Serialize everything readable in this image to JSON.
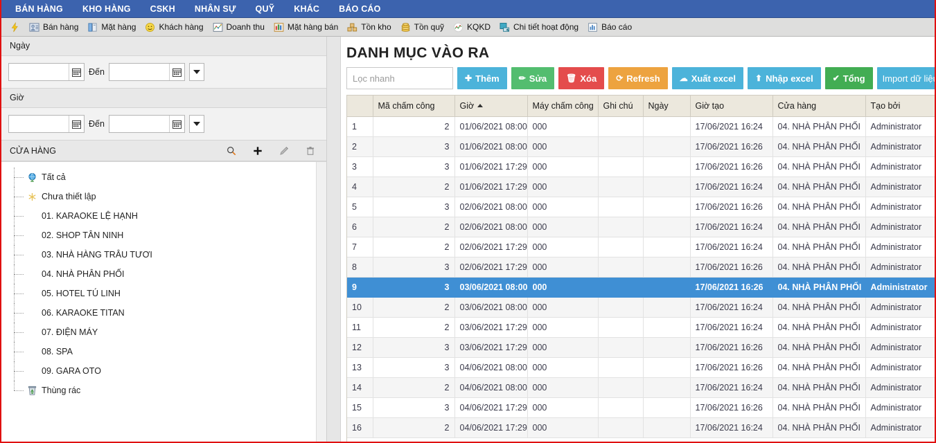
{
  "menubar": {
    "items": [
      {
        "label": "BÁN HÀNG",
        "name": "menu-ban-hang"
      },
      {
        "label": "KHO HÀNG",
        "name": "menu-kho-hang"
      },
      {
        "label": "CSKH",
        "name": "menu-cskh"
      },
      {
        "label": "NHÂN SỰ",
        "name": "menu-nhan-su"
      },
      {
        "label": "QUỸ",
        "name": "menu-quy"
      },
      {
        "label": "KHÁC",
        "name": "menu-khac"
      },
      {
        "label": "BÁO CÁO",
        "name": "menu-bao-cao"
      }
    ]
  },
  "toolbar": {
    "items": [
      {
        "label": "",
        "icon": "lightning-icon",
        "name": "toolbar-lightning"
      },
      {
        "label": "Bán hàng",
        "icon": "sales-person-icon",
        "name": "toolbar-ban-hang"
      },
      {
        "label": "Mặt hàng",
        "icon": "product-icon",
        "name": "toolbar-mat-hang"
      },
      {
        "label": "Khách hàng",
        "icon": "customer-face-icon",
        "name": "toolbar-khach-hang"
      },
      {
        "label": "Doanh thu",
        "icon": "revenue-chart-icon",
        "name": "toolbar-doanh-thu"
      },
      {
        "label": "Mặt hàng bán",
        "icon": "bar-chart-icon",
        "name": "toolbar-mat-hang-ban"
      },
      {
        "label": "Tồn kho",
        "icon": "boxes-icon",
        "name": "toolbar-ton-kho"
      },
      {
        "label": "Tồn quỹ",
        "icon": "coins-icon",
        "name": "toolbar-ton-quy"
      },
      {
        "label": "KQKD",
        "icon": "line-chart-icon",
        "name": "toolbar-kqkd"
      },
      {
        "label": "Chi tiết hoạt động",
        "icon": "activity-icon",
        "name": "toolbar-chi-tiet-hoat-dong"
      },
      {
        "label": "Báo cáo",
        "icon": "report-icon",
        "name": "toolbar-bao-cao"
      }
    ]
  },
  "filters": {
    "date": {
      "label": "Ngày",
      "from_value": "",
      "to_value": "",
      "between_label": "Đến"
    },
    "time": {
      "label": "Giờ",
      "from_value": "",
      "to_value": "",
      "between_label": "Đến"
    }
  },
  "store_panel": {
    "title": "CỬA HÀNG",
    "actions": [
      {
        "name": "search-icon",
        "glyph": "search"
      },
      {
        "name": "add-icon",
        "glyph": "plus"
      },
      {
        "name": "edit-icon",
        "glyph": "pencil"
      },
      {
        "name": "delete-icon",
        "glyph": "trash"
      }
    ],
    "tree": [
      {
        "label": "Tất cả",
        "icon": "globe-icon"
      },
      {
        "label": "Chưa thiết lập",
        "icon": "asterisk-icon"
      },
      {
        "label": "01. KARAOKE LỆ HẠNH",
        "icon": ""
      },
      {
        "label": "02. SHOP TÂN NINH",
        "icon": ""
      },
      {
        "label": "03. NHÀ HÀNG TRÂU TƯƠI",
        "icon": ""
      },
      {
        "label": "04. NHÀ PHÂN PHỐI",
        "icon": ""
      },
      {
        "label": "05. HOTEL TÚ LINH",
        "icon": ""
      },
      {
        "label": "06. KARAOKE TITAN",
        "icon": ""
      },
      {
        "label": "07. ĐIỆN MÁY",
        "icon": ""
      },
      {
        "label": "08. SPA",
        "icon": ""
      },
      {
        "label": "09. GARA OTO",
        "icon": ""
      },
      {
        "label": "Thùng rác",
        "icon": "recycle-bin-icon"
      }
    ]
  },
  "main": {
    "title": "DANH MỤC VÀO RA",
    "quick_filter_placeholder": "Lọc nhanh",
    "quick_filter_value": "",
    "buttons": [
      {
        "label": "Thêm",
        "glyph": "+",
        "name": "add-button"
      },
      {
        "label": "Sửa",
        "glyph": "✎",
        "name": "edit-button"
      },
      {
        "label": "Xóa",
        "glyph": "🗑",
        "name": "delete-button"
      },
      {
        "label": "Refresh",
        "glyph": "⟳",
        "name": "refresh-button"
      },
      {
        "label": "Xuất excel",
        "glyph": "☁",
        "name": "export-excel-button"
      },
      {
        "label": "Nhập excel",
        "glyph": "⬆",
        "name": "import-excel-button"
      },
      {
        "label": "Tổng",
        "glyph": "✔",
        "name": "total-button"
      },
      {
        "label": "Import dữ liệu vào ra",
        "glyph": "",
        "name": "import-data-button"
      }
    ],
    "colors": {
      "add": "#4cb3da",
      "edit": "#53bd6f",
      "delete": "#e44c4c",
      "refresh": "#eda33f",
      "total": "#42ad53",
      "selected_row": "#3f8fd4",
      "menubar": "#3c63ae",
      "border": "#e01010"
    },
    "table": {
      "columns": [
        {
          "label": "",
          "key": "idx",
          "cls": "c-idx"
        },
        {
          "label": "Mã chấm công",
          "key": "ma",
          "cls": "c-ma"
        },
        {
          "label": "Giờ",
          "key": "gio",
          "cls": "c-gio",
          "sort": "asc"
        },
        {
          "label": "Máy chấm công",
          "key": "may",
          "cls": "c-may"
        },
        {
          "label": "Ghi chú",
          "key": "ghichu",
          "cls": "c-ghi"
        },
        {
          "label": "Ngày",
          "key": "ngay",
          "cls": "c-ngay"
        },
        {
          "label": "Giờ tạo",
          "key": "giotao",
          "cls": "c-giotao"
        },
        {
          "label": "Cửa hàng",
          "key": "cuahang",
          "cls": "c-cuahang"
        },
        {
          "label": "Tạo bởi",
          "key": "taoboi",
          "cls": "c-taoboi"
        }
      ],
      "selected_index": 9,
      "rows": [
        {
          "idx": "1",
          "ma": "2",
          "gio": "01/06/2021 08:00",
          "may": "000",
          "ghichu": "",
          "ngay": "",
          "giotao": "17/06/2021 16:24",
          "cuahang": "04. NHÀ PHÂN PHỐI",
          "taoboi": "Administrator"
        },
        {
          "idx": "2",
          "ma": "3",
          "gio": "01/06/2021 08:00",
          "may": "000",
          "ghichu": "",
          "ngay": "",
          "giotao": "17/06/2021 16:26",
          "cuahang": "04. NHÀ PHÂN PHỐI",
          "taoboi": "Administrator"
        },
        {
          "idx": "3",
          "ma": "3",
          "gio": "01/06/2021 17:29",
          "may": "000",
          "ghichu": "",
          "ngay": "",
          "giotao": "17/06/2021 16:26",
          "cuahang": "04. NHÀ PHÂN PHỐI",
          "taoboi": "Administrator"
        },
        {
          "idx": "4",
          "ma": "2",
          "gio": "01/06/2021 17:29",
          "may": "000",
          "ghichu": "",
          "ngay": "",
          "giotao": "17/06/2021 16:24",
          "cuahang": "04. NHÀ PHÂN PHỐI",
          "taoboi": "Administrator"
        },
        {
          "idx": "5",
          "ma": "3",
          "gio": "02/06/2021 08:00",
          "may": "000",
          "ghichu": "",
          "ngay": "",
          "giotao": "17/06/2021 16:26",
          "cuahang": "04. NHÀ PHÂN PHỐI",
          "taoboi": "Administrator"
        },
        {
          "idx": "6",
          "ma": "2",
          "gio": "02/06/2021 08:00",
          "may": "000",
          "ghichu": "",
          "ngay": "",
          "giotao": "17/06/2021 16:24",
          "cuahang": "04. NHÀ PHÂN PHỐI",
          "taoboi": "Administrator"
        },
        {
          "idx": "7",
          "ma": "2",
          "gio": "02/06/2021 17:29",
          "may": "000",
          "ghichu": "",
          "ngay": "",
          "giotao": "17/06/2021 16:24",
          "cuahang": "04. NHÀ PHÂN PHỐI",
          "taoboi": "Administrator"
        },
        {
          "idx": "8",
          "ma": "3",
          "gio": "02/06/2021 17:29",
          "may": "000",
          "ghichu": "",
          "ngay": "",
          "giotao": "17/06/2021 16:26",
          "cuahang": "04. NHÀ PHÂN PHỐI",
          "taoboi": "Administrator"
        },
        {
          "idx": "9",
          "ma": "3",
          "gio": "03/06/2021 08:00",
          "may": "000",
          "ghichu": "",
          "ngay": "",
          "giotao": "17/06/2021 16:26",
          "cuahang": "04. NHÀ PHÂN PHỐI",
          "taoboi": "Administrator"
        },
        {
          "idx": "10",
          "ma": "2",
          "gio": "03/06/2021 08:00",
          "may": "000",
          "ghichu": "",
          "ngay": "",
          "giotao": "17/06/2021 16:24",
          "cuahang": "04. NHÀ PHÂN PHỐI",
          "taoboi": "Administrator"
        },
        {
          "idx": "11",
          "ma": "2",
          "gio": "03/06/2021 17:29",
          "may": "000",
          "ghichu": "",
          "ngay": "",
          "giotao": "17/06/2021 16:24",
          "cuahang": "04. NHÀ PHÂN PHỐI",
          "taoboi": "Administrator"
        },
        {
          "idx": "12",
          "ma": "3",
          "gio": "03/06/2021 17:29",
          "may": "000",
          "ghichu": "",
          "ngay": "",
          "giotao": "17/06/2021 16:26",
          "cuahang": "04. NHÀ PHÂN PHỐI",
          "taoboi": "Administrator"
        },
        {
          "idx": "13",
          "ma": "3",
          "gio": "04/06/2021 08:00",
          "may": "000",
          "ghichu": "",
          "ngay": "",
          "giotao": "17/06/2021 16:26",
          "cuahang": "04. NHÀ PHÂN PHỐI",
          "taoboi": "Administrator"
        },
        {
          "idx": "14",
          "ma": "2",
          "gio": "04/06/2021 08:00",
          "may": "000",
          "ghichu": "",
          "ngay": "",
          "giotao": "17/06/2021 16:24",
          "cuahang": "04. NHÀ PHÂN PHỐI",
          "taoboi": "Administrator"
        },
        {
          "idx": "15",
          "ma": "3",
          "gio": "04/06/2021 17:29",
          "may": "000",
          "ghichu": "",
          "ngay": "",
          "giotao": "17/06/2021 16:26",
          "cuahang": "04. NHÀ PHÂN PHỐI",
          "taoboi": "Administrator"
        },
        {
          "idx": "16",
          "ma": "2",
          "gio": "04/06/2021 17:29",
          "may": "000",
          "ghichu": "",
          "ngay": "",
          "giotao": "17/06/2021 16:24",
          "cuahang": "04. NHÀ PHÂN PHỐI",
          "taoboi": "Administrator"
        }
      ]
    }
  }
}
